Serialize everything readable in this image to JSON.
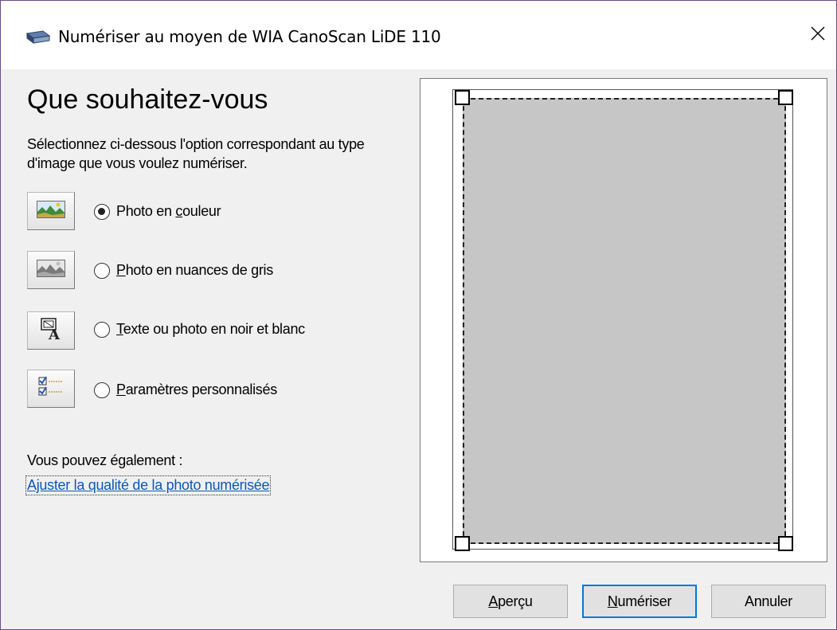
{
  "window": {
    "title": "Numériser au moyen de WIA CanoScan LiDE 110",
    "close_glyph": "✕"
  },
  "main": {
    "heading": "Que souhaitez-vous",
    "description": "Sélectionnez ci-dessous l'option correspondant au type d'image que vous voulez numériser.",
    "options": [
      {
        "pre": "Photo en ",
        "mn": "c",
        "post": "ouleur",
        "checked": true,
        "icon": "color-photo-icon"
      },
      {
        "pre": "",
        "mn": "P",
        "post": "hoto en nuances de gris",
        "checked": false,
        "icon": "grayscale-photo-icon"
      },
      {
        "pre": "",
        "mn": "T",
        "post": "exte ou photo en noir et blanc",
        "checked": false,
        "icon": "text-bw-icon"
      },
      {
        "pre": "",
        "mn": "P",
        "post": "aramètres personnalisés",
        "checked": false,
        "icon": "custom-settings-icon"
      }
    ],
    "also_label": "Vous pouvez également :",
    "link_label": "Ajuster la qualité de la photo numérisée"
  },
  "buttons": {
    "preview": {
      "mn": "A",
      "rest": "perçu"
    },
    "scan": {
      "mn": "N",
      "rest": "umériser"
    },
    "cancel": "Annuler"
  },
  "colors": {
    "accent": "#0078d7",
    "link": "#0b58b8",
    "scan_area": "#c6c6c6"
  }
}
